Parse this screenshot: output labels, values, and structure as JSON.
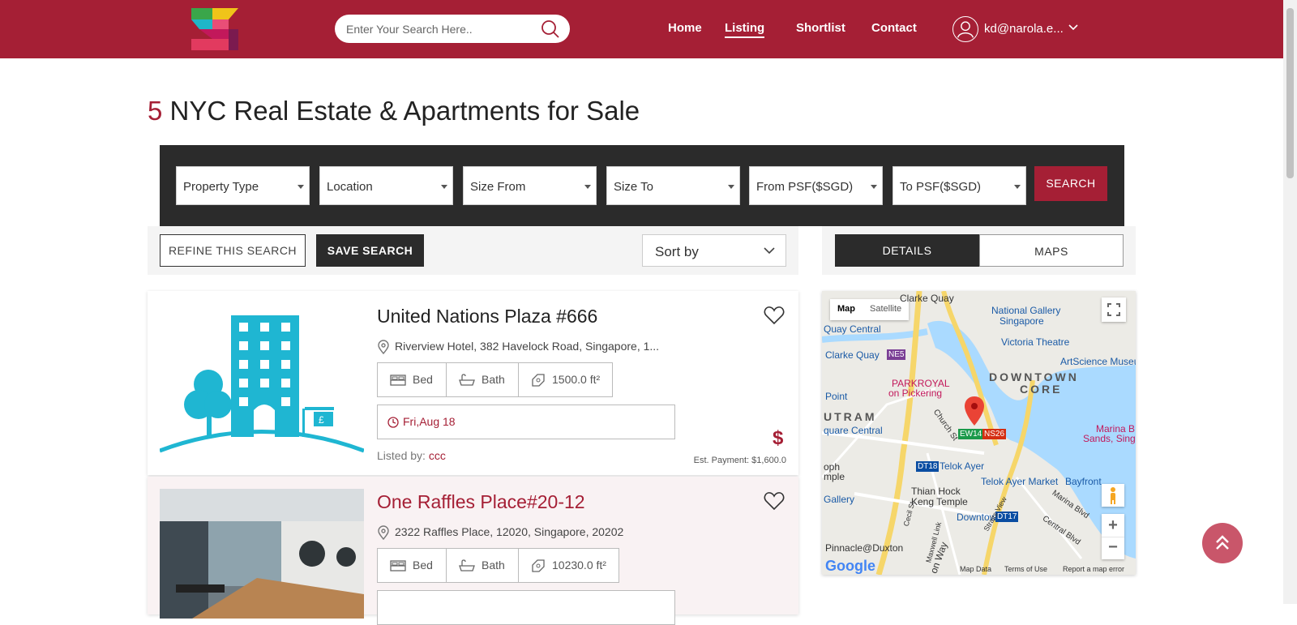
{
  "header": {
    "search_placeholder": "Enter Your Search Here..",
    "nav": [
      "Home",
      "Listing",
      "Shortlist",
      "Contact"
    ],
    "active_nav": "Listing",
    "user_email": "kd@narola.e..."
  },
  "title": {
    "count": "5",
    "text": "NYC Real Estate & Apartments for Sale"
  },
  "filters": {
    "property_type": "Property Type",
    "location": "Location",
    "size_from": "Size From",
    "size_to": "Size To",
    "from_psf": "From PSF($SGD)",
    "to_psf": "To PSF($SGD)",
    "search_button": "SEARCH"
  },
  "toolbar": {
    "refine": "REFINE THIS SEARCH",
    "save": "SAVE SEARCH",
    "sort": "Sort by"
  },
  "view_tabs": {
    "details": "DETAILS",
    "maps": "MAPS",
    "active": "DETAILS"
  },
  "listings": [
    {
      "title": "United Nations Plaza #666",
      "address": "Riverview Hotel, 382 Havelock Road, Singapore, 1...",
      "bed": "Bed",
      "bath": "Bath",
      "size": "1500.0 ft²",
      "date": "Fri,Aug 18",
      "listed_label": "Listed by:",
      "listed_by": "ccc",
      "currency": "$",
      "est_payment": "Est. Payment: $1,600.0"
    },
    {
      "title": "One Raffles Place#20-12",
      "address": "2322 Raffles Place, 12020, Singapore, 20202",
      "bed": "Bed",
      "bath": "Bath",
      "size": "10230.0 ft²"
    }
  ],
  "map": {
    "toggle_map": "Map",
    "toggle_satellite": "Satellite",
    "labels": {
      "clarke_quay_top": "Clarke Quay",
      "national_gallery": "National Gallery",
      "singapore": "Singapore",
      "quay_central": "Quay Central",
      "victoria_theatre": "Victoria Theatre",
      "clarke_quay": "Clarke Quay",
      "artscience": "ArtScience Museu",
      "downtown": "DOWNTOWN",
      "core": "CORE",
      "parkroyal": "PARKROYAL",
      "on_pickering": "on Pickering",
      "point": "Point",
      "outram": "UTRAM",
      "quare_central": "quare Central",
      "church_st": "Church St",
      "marina_bay": "Marina B",
      "sands": "Sands, Singapo",
      "telok_ayer": "Telok Ayer",
      "oph": "oph",
      "mple": "mple",
      "telok_ayer_market": "Telok Ayer Market",
      "bayfront": "Bayfront",
      "thian_hock": "Thian Hock",
      "keng_temple": "Keng Temple",
      "gallery": "Gallery",
      "marina_blvd": "Marina Blvd",
      "downtown_stn": "Downtown",
      "central_blvd": "Central Blvd",
      "pinnacle": "Pinnacle@Duxton",
      "on_way": "on Way",
      "cecil_st": "Cecil St",
      "maxwell_link": "Maxwell Link",
      "straits_view": "Straits View"
    },
    "stations": {
      "ne5": "NE5",
      "ew14": "EW14",
      "ns26": "NS26",
      "dt18": "DT18",
      "dt17": "DT17"
    },
    "footer": {
      "google": "Google",
      "data": "Map Data",
      "terms": "Terms of Use",
      "report": "Report a map error"
    },
    "zoom_in": "+",
    "zoom_out": "−"
  },
  "colors": {
    "brand": "#a51f35",
    "dark": "#2b2b2b"
  }
}
